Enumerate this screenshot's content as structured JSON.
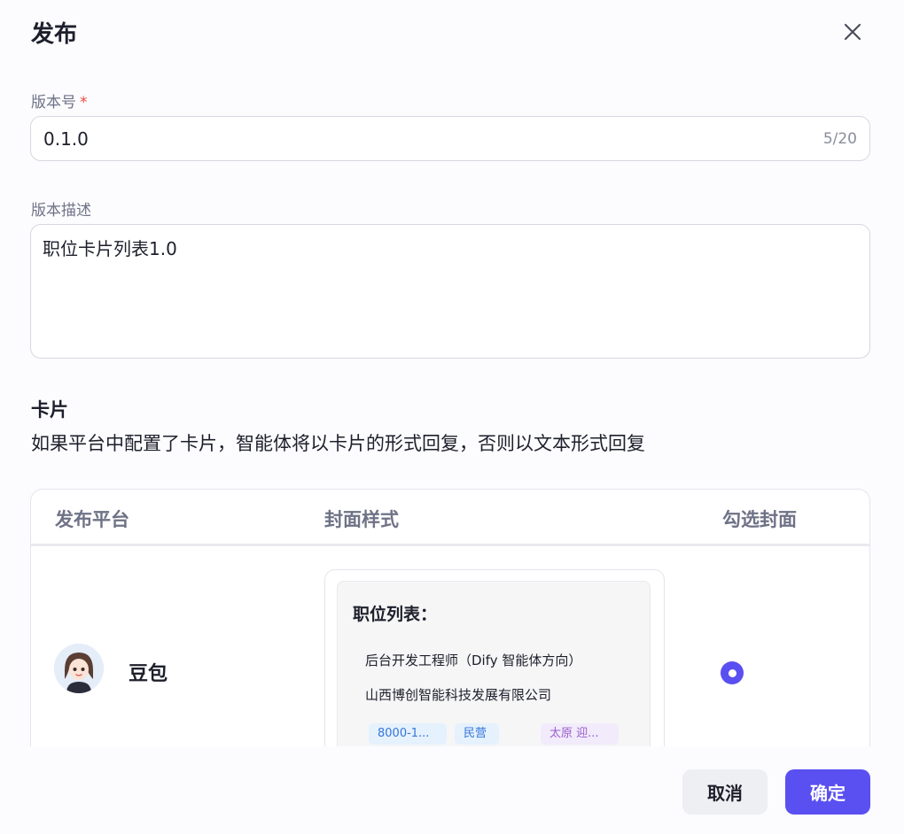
{
  "dialog": {
    "title": "发布"
  },
  "version": {
    "label": "版本号",
    "required_mark": "*",
    "value": "0.1.0",
    "counter": "5/20"
  },
  "description": {
    "label": "版本描述",
    "value": "职位卡片列表1.0"
  },
  "card_section": {
    "title": "卡片",
    "desc": "如果平台中配置了卡片，智能体将以卡片的形式回复，否则以文本形式回复"
  },
  "table": {
    "headers": [
      "发布平台",
      "封面样式",
      "勾选封面"
    ],
    "rows": [
      {
        "platform": "豆包",
        "avatar_icon": "doubao-avatar-icon",
        "cover": {
          "title": "职位列表：",
          "line1": "后台开发工程师（Dify 智能体方向）",
          "line2": "山西博创智能科技发展有限公司",
          "tags": [
            "8000-1...",
            "民营",
            "太原 迎..."
          ]
        },
        "selected": true
      }
    ]
  },
  "footer": {
    "cancel_label": "取消",
    "confirm_label": "确定"
  },
  "colors": {
    "accent": "#5a4ff0",
    "required": "#f0483e",
    "tag_blue_bg": "#e5f1fd",
    "tag_purple_bg": "#f1ebfb"
  }
}
